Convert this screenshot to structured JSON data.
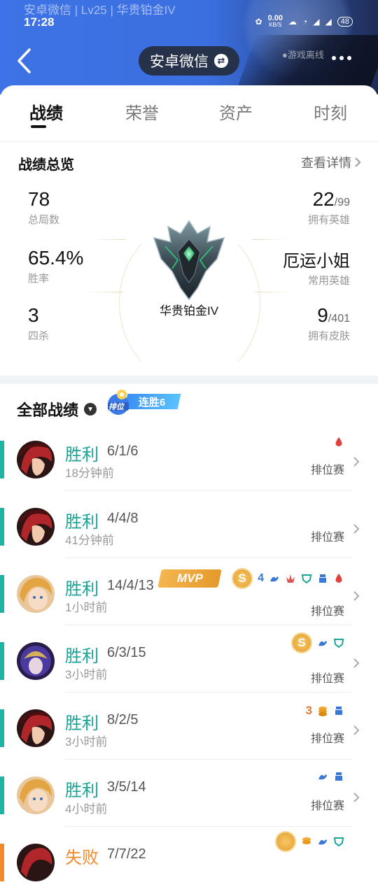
{
  "status_bar": {
    "title": "安卓微信 | Lv25 | 华贵铂金IV",
    "time": "17:28",
    "speed": "0.00",
    "speed_unit": "KB/S",
    "battery": "48"
  },
  "header": {
    "account_chip": "安卓微信",
    "game_status": "●游戏离线"
  },
  "tabs": [
    "战绩",
    "荣誉",
    "资产",
    "时刻"
  ],
  "overview": {
    "title": "战绩总览",
    "detail_link": "查看详情",
    "total_games": {
      "value": "78",
      "label": "总局数"
    },
    "win_rate": {
      "value": "65.4%",
      "label": "胜率"
    },
    "quadra_kills": {
      "value": "3",
      "label": "四杀"
    },
    "heroes": {
      "value": "22",
      "total": "/99",
      "label": "拥有英雄"
    },
    "common_hero": {
      "value": "厄运小姐",
      "label": "常用英雄"
    },
    "skins": {
      "value": "9",
      "total": "/401",
      "label": "拥有皮肤"
    },
    "rank": "华贵铂金IV"
  },
  "matches_section": {
    "title": "全部战绩",
    "badge_label": "排位",
    "streak": "连胜6"
  },
  "matches": [
    {
      "result": "胜利",
      "kda": "6/1/6",
      "time": "18分钟前",
      "mode": "排位赛"
    },
    {
      "result": "胜利",
      "kda": "4/4/8",
      "time": "41分钟前",
      "mode": "排位赛"
    },
    {
      "result": "胜利",
      "kda": "14/4/13",
      "time": "1小时前",
      "mode": "排位赛",
      "mvp": "MVP",
      "coin": "S",
      "kill_badge": "4"
    },
    {
      "result": "胜利",
      "kda": "6/3/15",
      "time": "3小时前",
      "mode": "排位赛",
      "coin": "S"
    },
    {
      "result": "胜利",
      "kda": "8/2/5",
      "time": "3小时前",
      "mode": "排位赛",
      "kill_badge": "3"
    },
    {
      "result": "胜利",
      "kda": "3/5/14",
      "time": "4小时前",
      "mode": "排位赛"
    },
    {
      "result": "失败",
      "kda": "7/7/22",
      "time": "",
      "mode": ""
    }
  ],
  "colors": {
    "win": "#1aa597",
    "loss": "#f08a2a",
    "header": "#3d73e6"
  }
}
